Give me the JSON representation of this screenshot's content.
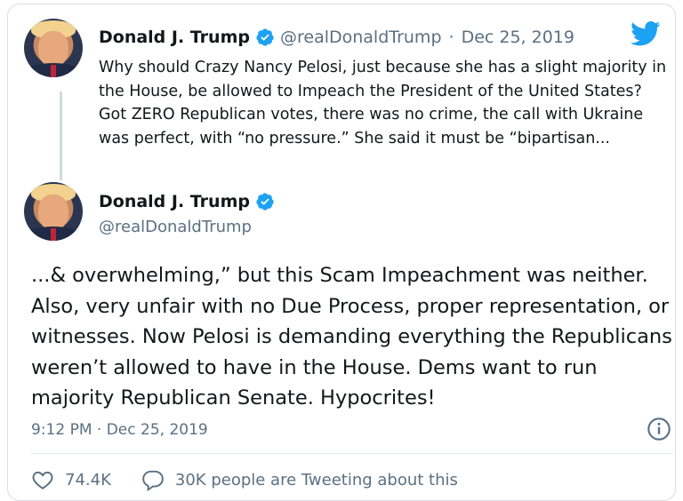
{
  "colors": {
    "verified": "#1da1f2",
    "brand": "#1da1f2",
    "secondary_text": "#5b7083"
  },
  "tweet1": {
    "author_name": "Donald J. Trump",
    "author_handle": "@realDonaldTrump",
    "separator": "·",
    "date": "Dec 25, 2019",
    "text": "Why should Crazy Nancy Pelosi, just because she has a slight majority in the House, be allowed to Impeach the President of the United States? Got ZERO Republican votes, there was no crime, the call with Ukraine was perfect, with “no pressure.” She said it must be “bipartisan..."
  },
  "tweet2": {
    "author_name": "Donald J. Trump",
    "author_handle": "@realDonaldTrump",
    "text": "...& overwhelming,” but this Scam Impeachment was neither. Also, very unfair with no Due Process, proper representation, or witnesses. Now Pelosi is demanding everything the Republicans weren’t allowed to have in the House. Dems want to run majority Republican Senate. Hypocrites!",
    "timestamp": "9:12 PM · Dec 25, 2019"
  },
  "actions": {
    "like_count": "74.4K",
    "conversation_label": "30K people are Tweeting about this"
  },
  "icons": [
    "twitter-bird-icon",
    "verified-badge-icon",
    "info-icon",
    "heart-icon",
    "reply-bubble-icon"
  ]
}
